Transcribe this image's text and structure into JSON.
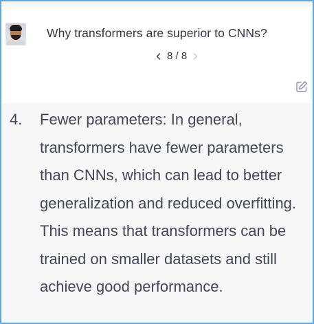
{
  "conversation": {
    "question": "Why transformers are superior to CNNs?",
    "pager": {
      "current": "8",
      "separator": "/",
      "total": "8",
      "prev_icon": "chevron-left-icon",
      "next_icon": "chevron-right-icon"
    },
    "edit_icon": "edit-icon",
    "avatar": "user-avatar"
  },
  "answer": {
    "item_number": "4.",
    "item_text": "Fewer parameters: In general, transformers have fewer parameters than CNNs, which can lead to better generalization and reduced overfitting. This means that transformers can be trained on smaller datasets and still achieve good performance."
  },
  "colors": {
    "frame_border": "#5aa6e6",
    "answer_bg": "#f7f7f8",
    "text": "#343541",
    "answer_text": "#444654",
    "disabled_chevron": "#c5c5d2"
  }
}
